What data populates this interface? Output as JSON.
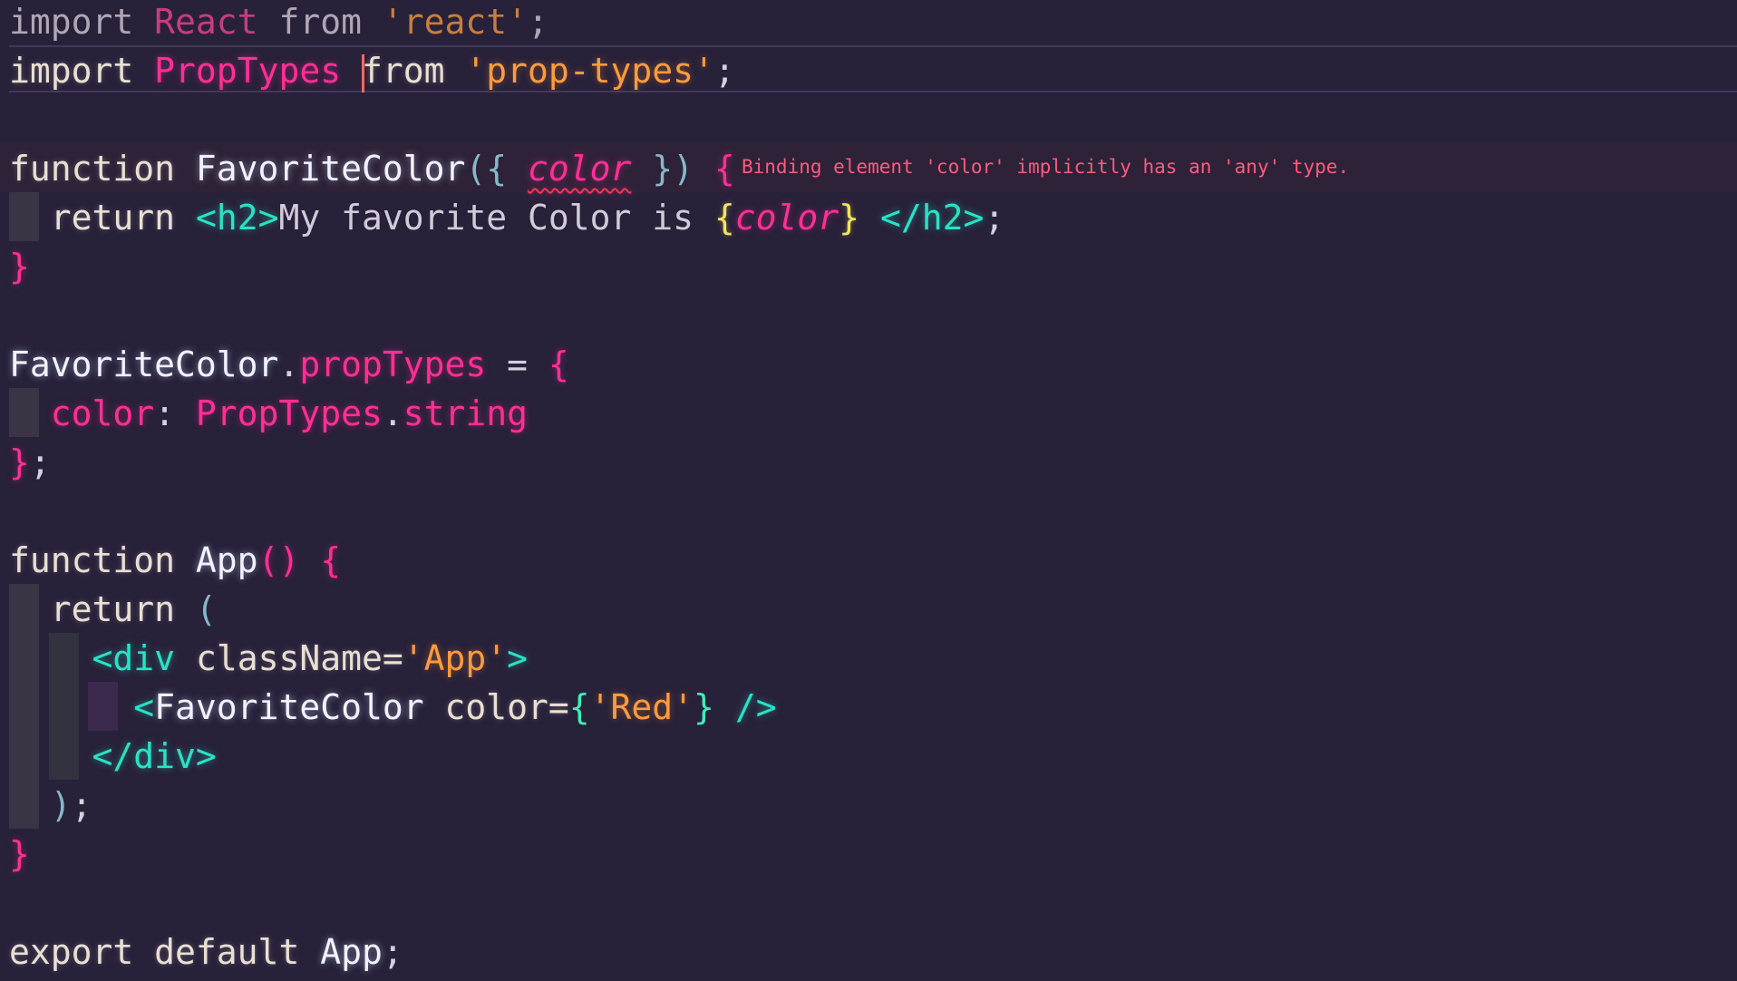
{
  "editor": {
    "language": "jsx",
    "colors": {
      "background": "#28213a",
      "keyword": "#e9dfd2",
      "identifier_pink": "#ff2f95",
      "string": "#ff9b3d",
      "tag": "#28e3c5",
      "error": "#ff5a7e"
    },
    "diagnostic": "Binding element 'color' implicitly has an 'any' type.",
    "t": {
      "import": "import",
      "from": "from",
      "react": "React",
      "react_str": "'react'",
      "semi": ";",
      "proptypes": "PropTypes",
      "proptypes_str": "'prop-types'",
      "function": "function",
      "favcolor": "FavoriteColor",
      "param_open": "({ ",
      "color": "color",
      "param_close": " }) ",
      "lbrace": "{",
      "rbrace": "}",
      "return": "return",
      "h2_open": "<h2>",
      "h2_text": "My favorite Color is ",
      "h2_close": "</h2>",
      "dot": ".",
      "proptypes_prop": "propTypes",
      "eq": " = ",
      "colon": ": ",
      "string": "string",
      "app": "App",
      "parens": "()",
      "lparen": "(",
      "rparen": ")",
      "div_lt": "<",
      "div": "div",
      "classname": "className=",
      "app_str": "'App'",
      "gt": ">",
      "fav_lt": "<",
      "color_attr": "color=",
      "red_str": "'Red'",
      "self_close": " />",
      "div_close": "</div>",
      "export": "export",
      "default": "default"
    }
  }
}
